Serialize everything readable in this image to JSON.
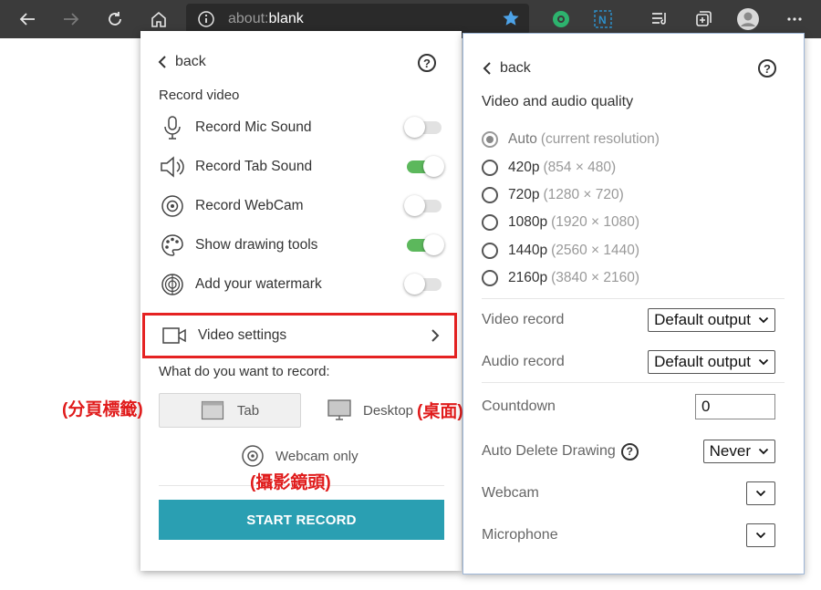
{
  "browser": {
    "url_prefix": "about:",
    "url_page": "blank"
  },
  "left_panel": {
    "back_label": "back",
    "help_label": "?",
    "section_title": "Record video",
    "options": [
      {
        "label": "Record Mic Sound",
        "icon": "microphone-icon",
        "on": false
      },
      {
        "label": "Record Tab Sound",
        "icon": "speaker-icon",
        "on": true
      },
      {
        "label": "Record WebCam",
        "icon": "webcam-icon",
        "on": false
      },
      {
        "label": "Show drawing tools",
        "icon": "palette-icon",
        "on": true
      },
      {
        "label": "Add your watermark",
        "icon": "watermark-icon",
        "on": false
      }
    ],
    "video_settings_label": "Video settings",
    "record_question": "What do you want to record:",
    "tab_label": "Tab",
    "desktop_label": "Desktop",
    "webcam_only_label": "Webcam only",
    "start_label": "START RECORD",
    "accent_color": "#2a9fb2",
    "highlight_color": "#e52222"
  },
  "annotations": {
    "tab": "(分頁標籤)",
    "desktop": "(桌面)",
    "webcam": "(攝影鏡頭)"
  },
  "right_panel": {
    "back_label": "back",
    "help_label": "?",
    "quality_title": "Video and audio quality",
    "resolutions": [
      {
        "label": "Auto",
        "detail": "(current resolution)",
        "selected": true
      },
      {
        "label": "420p",
        "detail": "(854 × 480)",
        "selected": false
      },
      {
        "label": "720p",
        "detail": "(1280 × 720)",
        "selected": false
      },
      {
        "label": "1080p",
        "detail": "(1920 × 1080)",
        "selected": false
      },
      {
        "label": "1440p",
        "detail": "(2560 × 1440)",
        "selected": false
      },
      {
        "label": "2160p",
        "detail": "(3840 × 2160)",
        "selected": false
      }
    ],
    "video_record_label": "Video record",
    "video_record_value": "Default output",
    "audio_record_label": "Audio record",
    "audio_record_value": "Default output",
    "countdown_label": "Countdown",
    "countdown_value": "0",
    "auto_delete_label": "Auto Delete Drawing",
    "auto_delete_value": "Never",
    "webcam_label": "Webcam",
    "microphone_label": "Microphone"
  }
}
